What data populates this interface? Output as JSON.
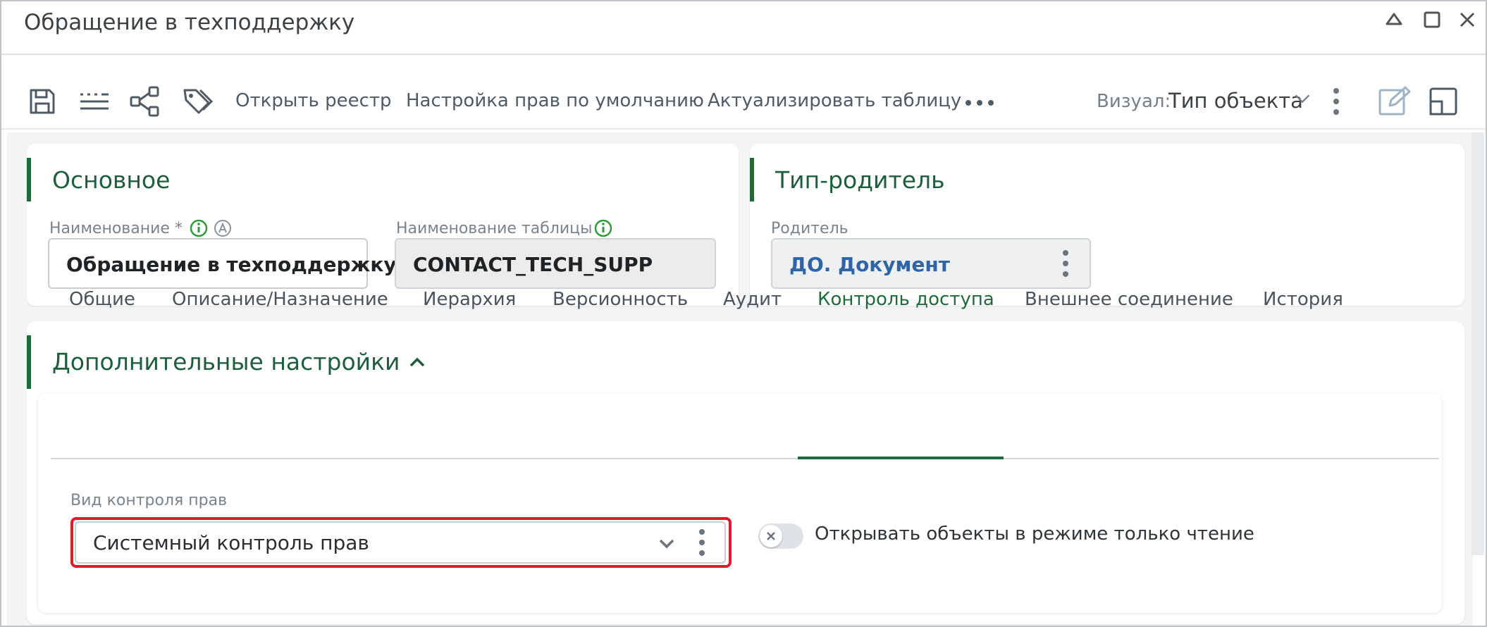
{
  "window": {
    "title": "Обращение в техподдержку"
  },
  "toolbar": {
    "links": [
      "Открыть реестр",
      "Настройка прав по умолчанию",
      "Актуализировать таблицу"
    ],
    "visual_label": "Визуал:",
    "visual_value": "Тип объекта",
    "icons": [
      "save-icon",
      "list-icon",
      "share-tree-icon",
      "tags-icon",
      "more-horizontal-icon",
      "more-vertical-icon",
      "edit-icon",
      "panel-icon"
    ]
  },
  "basic": {
    "title": "Основное",
    "name_label": "Наименование *",
    "name_value": "Обращение в техподдержку",
    "table_label": "Наименование таблицы",
    "table_value": "CONTACT_TECH_SUPP"
  },
  "parent": {
    "title": "Тип-родитель",
    "parent_label": "Родитель",
    "parent_value": "ДО. Документ"
  },
  "extra": {
    "title": "Дополнительные настройки",
    "tabs": [
      "Общие",
      "Описание/Назначение",
      "Иерархия",
      "Версионность",
      "Аудит",
      "Контроль доступа",
      "Внешнее соединение",
      "История"
    ],
    "active_tab": "Контроль доступа",
    "access_label": "Вид контроля прав",
    "access_value": "Системный контроль прав",
    "readonly_toggle_label": "Открывать объекты в режиме только чтение",
    "readonly_toggle_on": false
  },
  "colors": {
    "accent": "#1f6b3a",
    "link": "#2f65a8",
    "highlight": "#e01b2b"
  }
}
